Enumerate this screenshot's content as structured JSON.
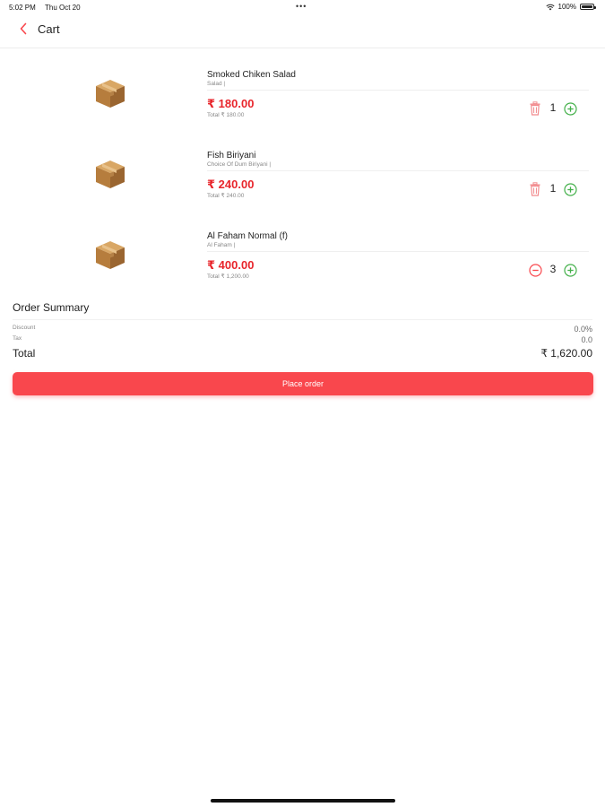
{
  "status_bar": {
    "time": "5:02 PM",
    "date": "Thu Oct 20",
    "dots": "•••",
    "battery": "100%"
  },
  "nav": {
    "title": "Cart",
    "back_icon": "chevron-left-icon"
  },
  "cart": {
    "items": [
      {
        "name": "Smoked Chiken Salad",
        "sub": "Salad |",
        "price": "₹ 180.00",
        "total": "Total ₹ 180.00",
        "qty": "1",
        "left_icon": "trash-icon"
      },
      {
        "name": "Fish Biriyani",
        "sub": "Choice Of Dum Biriyani |",
        "price": "₹ 240.00",
        "total": "Total ₹ 240.00",
        "qty": "1",
        "left_icon": "trash-icon"
      },
      {
        "name": "Al Faham Normal (f)",
        "sub": "Al Faham |",
        "price": "₹ 400.00",
        "total": "Total ₹ 1,200.00",
        "qty": "3",
        "left_icon": "minus-circle-icon"
      }
    ]
  },
  "summary": {
    "title": "Order Summary",
    "discount_label": "Discount",
    "discount_value": "0.0%",
    "tax_label": "Tax",
    "tax_value": "0.0",
    "total_label": "Total",
    "total_value": "₹ 1,620.00"
  },
  "actions": {
    "place_order": "Place order"
  },
  "colors": {
    "accent": "#f9474d",
    "price": "#e8262c",
    "plus": "#43b04a"
  }
}
